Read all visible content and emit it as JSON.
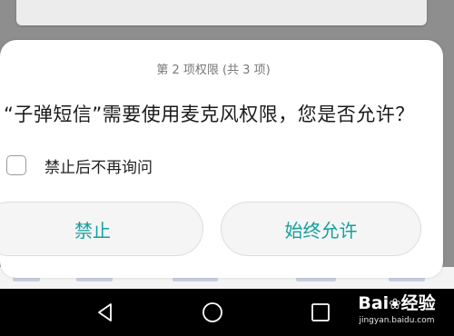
{
  "dialog": {
    "step_text": "第 2 项权限 (共 3 项)",
    "question": "“子弹短信”需要使用麦克风权限，您是否允许？",
    "checkbox_label": "禁止后不再询问",
    "deny_label": "禁止",
    "allow_label": "始终允许",
    "accent_color": "#14a09e"
  },
  "navbar": {
    "back_icon": "back-triangle-icon",
    "home_icon": "home-circle-icon",
    "recent_icon": "recent-apps-square-icon"
  },
  "watermark": {
    "brand_a": "Bai",
    "brand_b": "经验",
    "url": "jingyan.baidu.com"
  }
}
